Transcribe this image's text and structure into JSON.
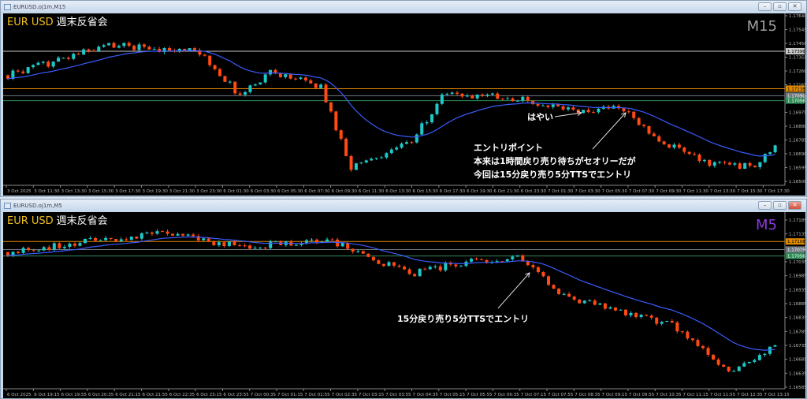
{
  "windows": [
    {
      "title": "EURUSD.oj1m,M15",
      "symbol": "EUR USD",
      "caption": "週末反省会",
      "timeframe": "M15",
      "timeframe_color": "#a0a0a0",
      "price_labels": [
        "1.17640",
        "1.17545",
        "1.17450",
        "1.17355",
        "1.17260",
        "1.17165",
        "1.17070",
        "1.16975",
        "1.16880",
        "1.16785",
        "1.16690",
        "1.16595",
        "1.16500"
      ],
      "price_range": [
        1.165,
        1.1764
      ],
      "levels": [
        {
          "price": "1.17396",
          "value": 1.17396,
          "color": "#c8c8c8",
          "text_color": "#000"
        },
        {
          "price": "1.17138",
          "value": 1.17138,
          "color": "#e08a00",
          "text_color": "#000"
        },
        {
          "price": "1.17090",
          "value": 1.1709,
          "color": "#707880",
          "text_color": "#fff"
        },
        {
          "price": "1.17056",
          "value": 1.17056,
          "color": "#2e8b57",
          "text_color": "#fff"
        }
      ],
      "time_labels": [
        "3 Oct 2025",
        "3 Oct 11:30",
        "3 Oct 13:30",
        "3 Oct 15:30",
        "3 Oct 17:30",
        "3 Oct 19:30",
        "3 Oct 21:30",
        "3 Oct 23:30",
        "6 Oct 01:30",
        "6 Oct 03:30",
        "6 Oct 05:30",
        "6 Oct 07:30",
        "6 Oct 09:30",
        "6 Oct 11:30",
        "6 Oct 13:30",
        "6 Oct 15:30",
        "6 Oct 17:30",
        "6 Oct 19:30",
        "6 Oct 21:30",
        "6 Oct 23:30",
        "7 Oct 01:30",
        "7 Oct 03:30",
        "7 Oct 05:30",
        "7 Oct 07:30",
        "7 Oct 09:30",
        "7 Oct 11:30",
        "7 Oct 13:30",
        "7 Oct 15:30",
        "7 Oct 17:30"
      ],
      "price_path": [
        [
          0,
          1.1723
        ],
        [
          20,
          1.1744
        ],
        [
          38,
          1.1739
        ],
        [
          46,
          1.1709
        ],
        [
          52,
          1.1726
        ],
        [
          62,
          1.1715
        ],
        [
          68,
          1.166
        ],
        [
          72,
          1.1666
        ],
        [
          80,
          1.1677
        ],
        [
          86,
          1.1709
        ],
        [
          98,
          1.1709
        ],
        [
          113,
          1.1698
        ],
        [
          121,
          1.1701
        ],
        [
          130,
          1.1677
        ],
        [
          138,
          1.1663
        ],
        [
          148,
          1.166
        ],
        [
          152,
          1.1674
        ]
      ],
      "annotations": {
        "fast": "はやい",
        "entry_title": "エントリポイント",
        "entry_line1": "本来は1時間戻り売り待ちがセオリーだが",
        "entry_line2": "今回は15分戻り売り5分TTSでエントリ"
      }
    },
    {
      "title": "EURUSD.oj1m,M5",
      "symbol": "EUR USD",
      "caption": "週末反省会",
      "timeframe": "M5",
      "timeframe_color": "#8a3ad8",
      "price_labels": [
        "1.17185",
        "1.17135",
        "1.17085",
        "1.17035",
        "1.16985",
        "1.16935",
        "1.16885",
        "1.16835",
        "1.16785",
        "1.16735",
        "1.16685",
        "1.16635",
        "1.16585"
      ],
      "price_range": [
        1.16585,
        1.17185
      ],
      "levels": [
        {
          "price": "1.17108",
          "value": 1.17108,
          "color": "#e08a00",
          "text_color": "#000"
        },
        {
          "price": "1.17079",
          "value": 1.17079,
          "color": "#707880",
          "text_color": "#fff"
        },
        {
          "price": "1.17056",
          "value": 1.17056,
          "color": "#2e8b57",
          "text_color": "#fff"
        }
      ],
      "time_labels": [
        "6 Oct 2025",
        "6 Oct 19:15",
        "6 Oct 19:55",
        "6 Oct 20:35",
        "6 Oct 21:15",
        "6 Oct 21:55",
        "6 Oct 22:35",
        "6 Oct 23:15",
        "6 Oct 23:55",
        "7 Oct 00:35",
        "7 Oct 01:15",
        "7 Oct 01:55",
        "7 Oct 02:35",
        "7 Oct 03:15",
        "7 Oct 03:55",
        "7 Oct 04:35",
        "7 Oct 05:15",
        "7 Oct 05:55",
        "7 Oct 06:35",
        "7 Oct 07:15",
        "7 Oct 07:55",
        "7 Oct 08:35",
        "7 Oct 09:15",
        "7 Oct 09:55",
        "7 Oct 10:35",
        "7 Oct 11:15",
        "7 Oct 11:55",
        "7 Oct 12:35",
        "7 Oct 13:15"
      ],
      "price_path": [
        [
          0,
          1.1707
        ],
        [
          30,
          1.1714
        ],
        [
          45,
          1.1709
        ],
        [
          63,
          1.1711
        ],
        [
          78,
          1.1699
        ],
        [
          90,
          1.1704
        ],
        [
          99,
          1.1705
        ],
        [
          108,
          1.1691
        ],
        [
          120,
          1.1685
        ],
        [
          129,
          1.1681
        ],
        [
          140,
          1.1664
        ],
        [
          149,
          1.1673
        ]
      ],
      "annotations": {
        "entry": "15分戻り売り5分TTSでエントリ"
      }
    }
  ],
  "window_buttons": {
    "minimize": "–",
    "restore": "▫",
    "close": "✕"
  },
  "colors": {
    "bull": "#1fc8c8",
    "bear": "#ff4a14",
    "ma": "#3a5cff"
  }
}
